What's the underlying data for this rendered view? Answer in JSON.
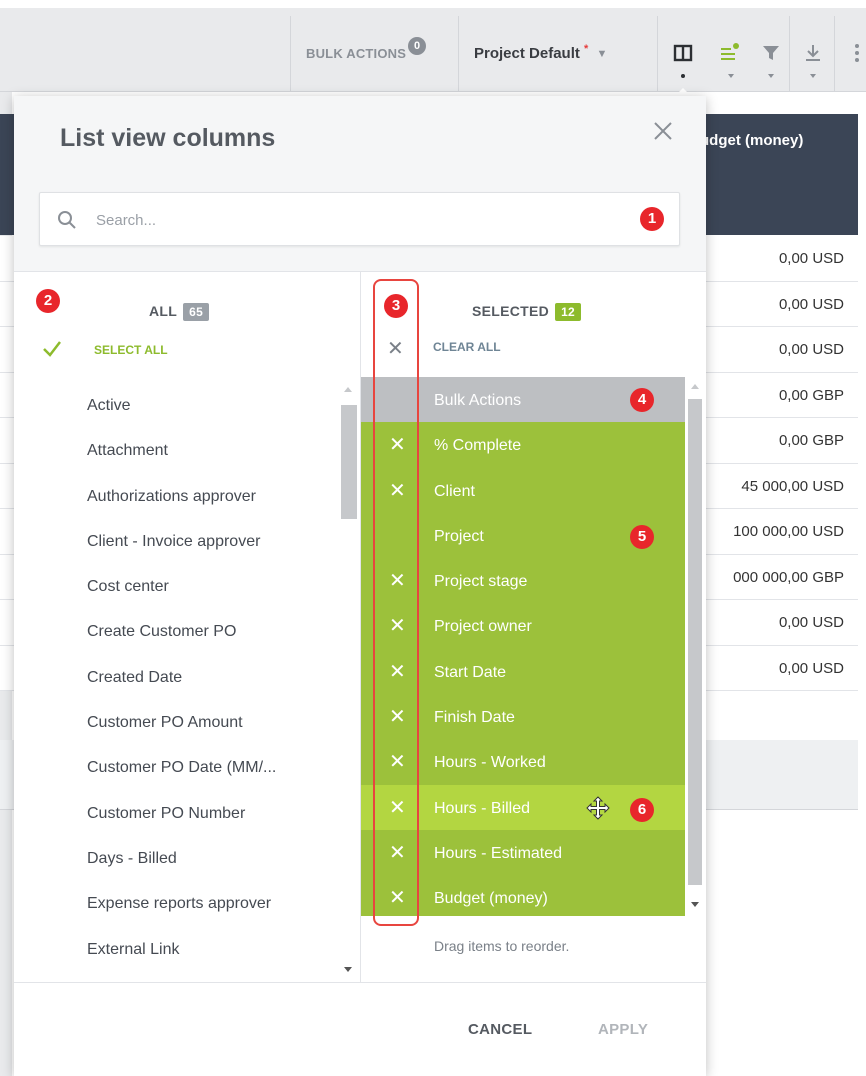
{
  "toolbar": {
    "bulk_actions_label": "BULK ACTIONS",
    "bulk_actions_count": "0",
    "view_name": "Project Default",
    "required_marker": "*",
    "icons": [
      "columns-icon",
      "list-settings-icon",
      "filter-icon",
      "download-icon",
      "more-icon"
    ]
  },
  "table": {
    "visible_header": "udget (money)",
    "rows": [
      "0,00 USD",
      "0,00 USD",
      "0,00 USD",
      "0,00 GBP",
      "0,00 GBP",
      "45 000,00 USD",
      "100 000,00 USD",
      "000 000,00 GBP",
      "0,00 USD",
      "0,00 USD"
    ]
  },
  "modal": {
    "title": "List view columns",
    "search": {
      "placeholder": "Search..."
    },
    "all": {
      "label": "ALL",
      "count": "65",
      "select_all": "SELECT ALL",
      "items": [
        "Active",
        "Attachment",
        "Authorizations approver",
        "Client - Invoice approver",
        "Cost center",
        "Create Customer PO",
        "Created Date",
        "Customer PO Amount",
        "Customer PO Date (MM/...",
        "Customer PO Number",
        "Days - Billed",
        "Expense reports approver",
        "External Link"
      ]
    },
    "selected": {
      "label": "SELECTED",
      "count": "12",
      "clear_all": "CLEAR ALL",
      "items": [
        {
          "label": "Bulk Actions",
          "removable": false,
          "state": "fixed"
        },
        {
          "label": "% Complete",
          "removable": true,
          "state": "normal"
        },
        {
          "label": "Client",
          "removable": true,
          "state": "normal"
        },
        {
          "label": "Project",
          "removable": false,
          "state": "normal"
        },
        {
          "label": "Project stage",
          "removable": true,
          "state": "normal"
        },
        {
          "label": "Project owner",
          "removable": true,
          "state": "normal"
        },
        {
          "label": "Start Date",
          "removable": true,
          "state": "normal"
        },
        {
          "label": "Finish Date",
          "removable": true,
          "state": "normal"
        },
        {
          "label": "Hours - Worked",
          "removable": true,
          "state": "normal"
        },
        {
          "label": "Hours - Billed",
          "removable": true,
          "state": "dragging"
        },
        {
          "label": "Hours - Estimated",
          "removable": true,
          "state": "normal"
        },
        {
          "label": "Budget (money)",
          "removable": true,
          "state": "normal"
        }
      ],
      "remove_glyph": "✕",
      "drag_hint": "Drag items to reorder."
    },
    "footer": {
      "cancel": "CANCEL",
      "apply": "APPLY"
    }
  },
  "annotations": [
    "1",
    "2",
    "3",
    "4",
    "5",
    "6"
  ],
  "colors": {
    "accent_green": "#9cc13b",
    "drag_green": "#b3d641",
    "header_dark": "#3b4556",
    "annotation_red": "#e8262b"
  }
}
